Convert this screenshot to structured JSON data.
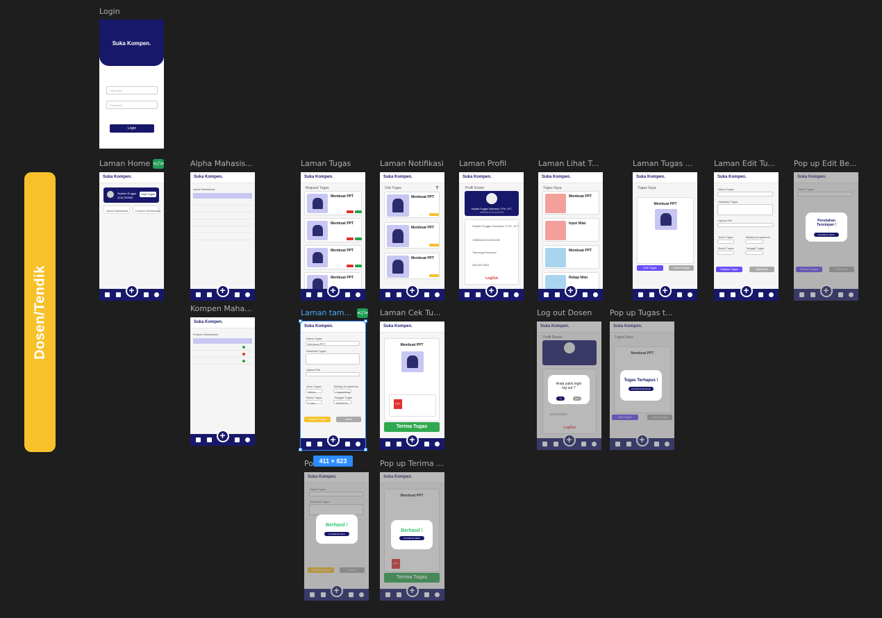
{
  "side_label": "Dosen/Tendik",
  "brand": "Suka Kompen.",
  "frames": {
    "login": "Login",
    "home": "Laman Home",
    "alpha": "Alpha Mahasis...",
    "kompen": "Kompen Maha...",
    "tugas": "Laman Tugas",
    "tambah": "Laman tam...",
    "notifikasi": "Laman Notifikasi",
    "cek": "Laman Cek Tu...",
    "profil": "Laman Profil",
    "lihat": "Laman Lihat T...",
    "logout": "Log out Dosen",
    "tugas_saya": "Laman Tugas ...",
    "popup_tugas": "Pop up Tugas t...",
    "edit": "Laman Edit Tu...",
    "popup_edit": "Pop up Edit Be...",
    "popup_tambah": "Po",
    "popup_terima": "Pop up Terima ..."
  },
  "size_badge": "411 × 823",
  "login": {
    "username": "Username",
    "password": "Password",
    "button": "Login"
  },
  "home": {
    "name": "Septian Enggar",
    "nip": "2241760069",
    "button": "Lihat Tugas",
    "alpha": "Alpha Mahasiswa",
    "kompen": "Kompen Mahasiswa"
  },
  "table": {
    "alpha_title": "Alpha Mahasiswa",
    "kompen_title": "Kompen Mahasiswa"
  },
  "tugas": {
    "title": "Request Tugas",
    "items": [
      "Membuat PPT",
      "Membuat PPT",
      "Membuat PPT",
      "Membuat PPT"
    ]
  },
  "notif": {
    "title": "Cek Tugas",
    "items": [
      "Membuat PPT",
      "Membuat PPT",
      "Membuat PPT"
    ],
    "filter_icon": "filter-icon"
  },
  "profil": {
    "title": "Profil Dosen",
    "name": "Septian Enggar Sukmana, S.Pd., M.T.",
    "nip": "198608012019031009",
    "fields": [
      "Septian Enggar Sukmana, S.Pd., M.T.",
      "198608012019031009",
      "Teknologi Informasi",
      "08123372541"
    ],
    "logout": "LogOut"
  },
  "lihat": {
    "title": "Tugas Saya",
    "items": [
      "Membuat PPT",
      "Input Nilai",
      "Membuat PPT",
      "Rekap Nilai"
    ]
  },
  "logout": {
    "title": "Profil Dosen",
    "question": "Anda yakin ingin log out ?",
    "yes": "Ya",
    "no": "Batal",
    "phone": "08123372541",
    "logout": "LogOut"
  },
  "tugas_saya": {
    "title": "Tugas Saya",
    "card_title": "Membuat PPT",
    "edit": "Edit Tugas",
    "delete": "Hapus Tugas"
  },
  "popup_hapus": {
    "title": "Tugas Saya",
    "card_title": "Membuat PPT",
    "message": "Tugas Terhapus !",
    "button": "Kembali ke Beranda",
    "edit": "Edit Tugas",
    "delete": "Hapus Tugas"
  },
  "form": {
    "nama": "Nama Tugas",
    "nama_val": "Membuat PPT",
    "desk": "Deskripsi Tugas",
    "upload": "Upload File",
    "jenis": "Jenis Tugas",
    "jenis_val": "Teknis",
    "bidang": "Bidang Kompetensi",
    "bidang_val": "Copywriting",
    "bobot": "Bobot Tugas",
    "bobot_val": "5 Jam",
    "tanggal": "Tanggal Tugas",
    "tanggal_val": "12/8/2024",
    "simpan": "Simpan Tugas",
    "batal": "Batal",
    "simpan_edit": "Simpan Tugas",
    "batal_edit": "Batal Edit"
  },
  "popup_edit": {
    "message": "Perubahan Tersimpan !",
    "button": "Kembali ke Home"
  },
  "cek": {
    "card_title": "Membuat PPT",
    "terima": "Terima Tugas",
    "file": "PPT"
  },
  "popup_berhasil": {
    "message": "Berhasil !",
    "button": "Kembali ke home"
  },
  "popup_terima": {
    "message": "Berhasil !",
    "button": "Kembali ke daftar"
  }
}
